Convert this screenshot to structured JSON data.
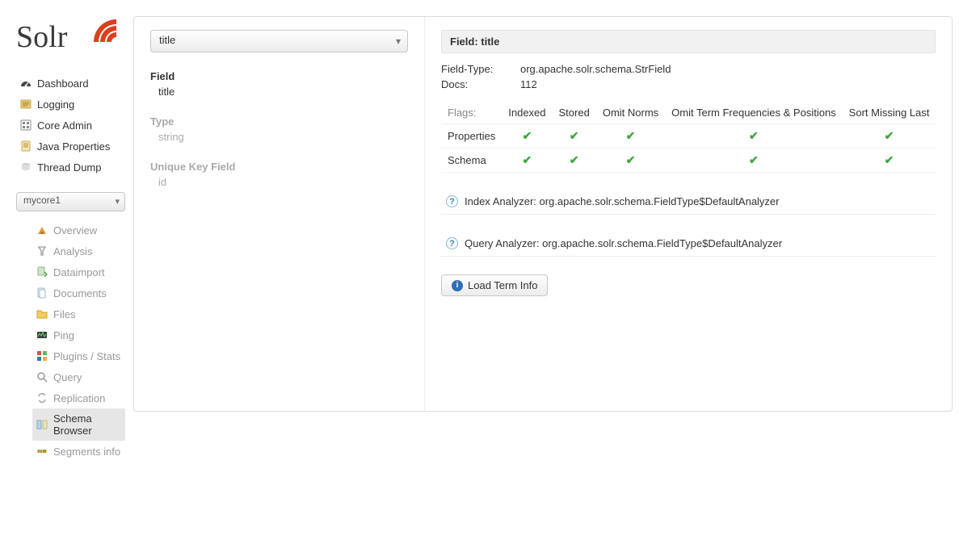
{
  "logo_text": "Solr",
  "sidebar": {
    "items": [
      {
        "label": "Dashboard",
        "icon": "dashboard-icon"
      },
      {
        "label": "Logging",
        "icon": "logging-icon"
      },
      {
        "label": "Core Admin",
        "icon": "core-admin-icon"
      },
      {
        "label": "Java Properties",
        "icon": "java-properties-icon"
      },
      {
        "label": "Thread Dump",
        "icon": "thread-dump-icon"
      }
    ],
    "core_selected": "mycore1",
    "sub_items": [
      {
        "label": "Overview",
        "icon": "overview-icon"
      },
      {
        "label": "Analysis",
        "icon": "analysis-icon"
      },
      {
        "label": "Dataimport",
        "icon": "dataimport-icon"
      },
      {
        "label": "Documents",
        "icon": "documents-icon"
      },
      {
        "label": "Files",
        "icon": "files-icon"
      },
      {
        "label": "Ping",
        "icon": "ping-icon"
      },
      {
        "label": "Plugins / Stats",
        "icon": "plugins-icon"
      },
      {
        "label": "Query",
        "icon": "query-icon"
      },
      {
        "label": "Replication",
        "icon": "replication-icon"
      },
      {
        "label": "Schema Browser",
        "icon": "schema-browser-icon",
        "active": true
      },
      {
        "label": "Segments info",
        "icon": "segments-icon"
      }
    ]
  },
  "left": {
    "field_select_value": "title",
    "field_label": "Field",
    "field_value": "title",
    "type_label": "Type",
    "type_value": "string",
    "ukf_label": "Unique Key Field",
    "ukf_value": "id"
  },
  "right": {
    "header": "Field: title",
    "field_type_label": "Field-Type:",
    "field_type_value": "org.apache.solr.schema.StrField",
    "docs_label": "Docs:",
    "docs_value": "112",
    "flags_label": "Flags:",
    "flag_cols": [
      "Indexed",
      "Stored",
      "Omit Norms",
      "Omit Term Frequencies & Positions",
      "Sort Missing Last"
    ],
    "flag_rows": [
      {
        "label": "Properties",
        "checks": [
          true,
          true,
          true,
          true,
          true
        ]
      },
      {
        "label": "Schema",
        "checks": [
          true,
          true,
          true,
          true,
          true
        ]
      }
    ],
    "index_analyzer": "Index Analyzer: org.apache.solr.schema.FieldType$DefaultAnalyzer",
    "query_analyzer": "Query Analyzer: org.apache.solr.schema.FieldType$DefaultAnalyzer",
    "load_btn": "Load Term Info"
  }
}
